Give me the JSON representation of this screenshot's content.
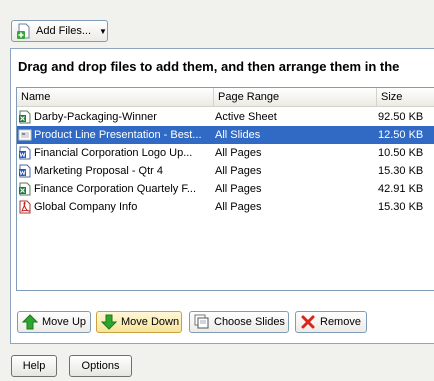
{
  "toolbar": {
    "add_files_label": "Add Files..."
  },
  "instruction": "Drag and drop files to add them, and then arrange them in the",
  "columns": {
    "name": "Name",
    "page_range": "Page Range",
    "size": "Size"
  },
  "rows": [
    {
      "name": "Darby-Packaging-Winner",
      "page_range": "Active Sheet",
      "size": "92.50 KB",
      "icon": "excel-file-icon"
    },
    {
      "name": "Product Line Presentation - Best...",
      "page_range": "All Slides",
      "size": "12.50 KB",
      "icon": "powerpoint-file-icon",
      "selected": true
    },
    {
      "name": "Financial Corporation Logo Up...",
      "page_range": "All Pages",
      "size": "10.50 KB",
      "icon": "word-file-icon"
    },
    {
      "name": "Marketing Proposal - Qtr 4",
      "page_range": "All Pages",
      "size": "15.30 KB",
      "icon": "word-file-icon"
    },
    {
      "name": "Finance Corporation Quartely F...",
      "page_range": "All Pages",
      "size": "42.91 KB",
      "icon": "excel-file-icon"
    },
    {
      "name": "Global Company Info",
      "page_range": "All Pages",
      "size": "15.30 KB",
      "icon": "pdf-file-icon"
    }
  ],
  "actions": {
    "move_up": "Move Up",
    "move_down": "Move Down",
    "choose_slides": "Choose Slides",
    "remove": "Remove"
  },
  "footer": {
    "help": "Help",
    "options": "Options"
  },
  "colors": {
    "selection": "#316ac5",
    "panel_border": "#8ea4c1"
  }
}
